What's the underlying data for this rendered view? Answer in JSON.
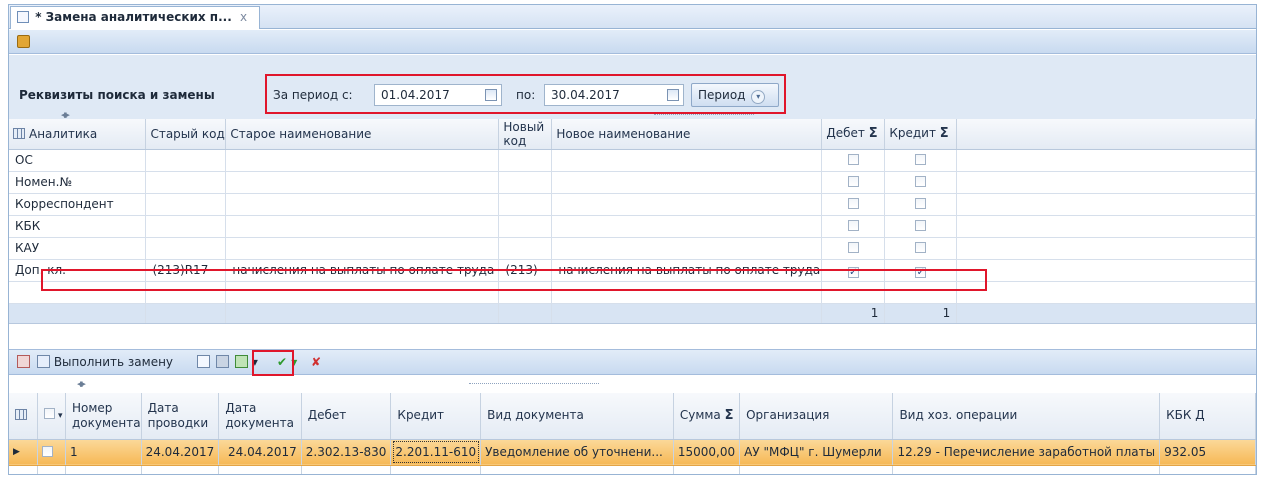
{
  "tab": {
    "title": "* Замена аналитических п...",
    "close": "x"
  },
  "search_panel": {
    "title": "Реквизиты поиска и замены",
    "period_from_label": "За период с:",
    "date_from": "01.04.2017",
    "period_to_label": "по:",
    "date_to": "30.04.2017",
    "period_button": "Период"
  },
  "top_grid": {
    "columns": [
      "Аналитика",
      "Старый код",
      "Старое наименование",
      "Новый код",
      "Новое наименование",
      "Дебет",
      "Кредит"
    ],
    "sigma": "Σ",
    "rows": [
      {
        "analytic": "ОС",
        "old_code": "",
        "old_name": "",
        "new_code": "",
        "new_name": "",
        "debit": false,
        "credit": false
      },
      {
        "analytic": "Номен.№",
        "old_code": "",
        "old_name": "",
        "new_code": "",
        "new_name": "",
        "debit": false,
        "credit": false
      },
      {
        "analytic": "Корреспондент",
        "old_code": "",
        "old_name": "",
        "new_code": "",
        "new_name": "",
        "debit": false,
        "credit": false
      },
      {
        "analytic": "КБК",
        "old_code": "",
        "old_name": "",
        "new_code": "",
        "new_name": "",
        "debit": false,
        "credit": false
      },
      {
        "analytic": "КАУ",
        "old_code": "",
        "old_name": "",
        "new_code": "",
        "new_name": "",
        "debit": false,
        "credit": false
      },
      {
        "analytic": "Доп. кл.",
        "old_code": "(213)R17",
        "old_name": "начисления на выплаты по оплате труда",
        "new_code": "(213)",
        "new_name": "начисления на выплаты по оплате труда",
        "debit": true,
        "credit": true
      }
    ],
    "footer": {
      "debit_count": "1",
      "credit_count": "1"
    }
  },
  "toolbar2": {
    "execute_replace": "Выполнить замену"
  },
  "bottom_grid": {
    "columns": [
      "Номер документа",
      "Дата проводки",
      "Дата документа",
      "Дебет",
      "Кредит",
      "Вид документа",
      "Сумма",
      "Организация",
      "Вид хоз. операции",
      "КБК Д"
    ],
    "sigma": "Σ",
    "rows": [
      {
        "number": "1",
        "posting_date": "24.04.2017",
        "doc_date": "24.04.2017",
        "debit": "2.302.13-830",
        "credit": "2.201.11-610",
        "doc_type": "Уведомление об уточнени...",
        "amount": "15000,00",
        "org": "АУ \"МФЦ\" г. Шумерли",
        "operation": "12.29 - Перечисление заработной платы",
        "kbk": "932.05"
      }
    ]
  },
  "colors": {
    "highlight_red": "#e0162b",
    "selected_row": "#f6b856",
    "panel_blue": "#dfe9f5"
  }
}
